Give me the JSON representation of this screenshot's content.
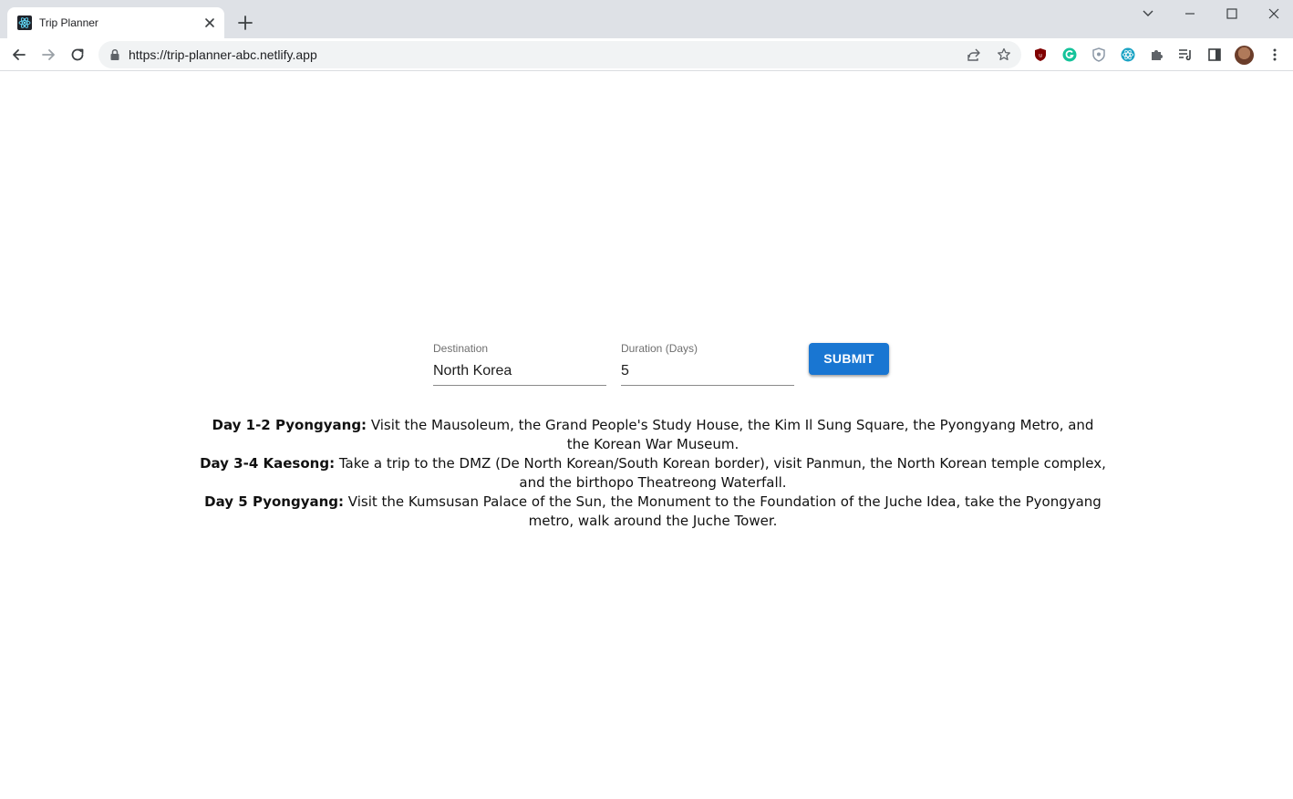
{
  "browser": {
    "tab": {
      "title": "Trip Planner",
      "favicon": "react-atom-icon"
    },
    "address_bar": {
      "url": "https://trip-planner-abc.netlify.app"
    },
    "colors": {
      "tab_strip": "#dee1e6",
      "omnibox": "#f1f3f4"
    }
  },
  "form": {
    "destination": {
      "label": "Destination",
      "value": "North Korea"
    },
    "duration": {
      "label": "Duration (Days)",
      "value": "5"
    },
    "submit_label": "SUBMIT",
    "submit_color": "#1976d2"
  },
  "itinerary": [
    {
      "heading": "Day 1-2 Pyongyang:",
      "text": " Visit the Mausoleum, the Grand People's Study House, the Kim Il Sung Square, the Pyongyang Metro, and the Korean War Museum."
    },
    {
      "heading": "Day 3-4 Kaesong:",
      "text": " Take a trip to the DMZ (De North Korean/South Korean border), visit Panmun, the North Korean temple complex, and the birthopo Theatreong Waterfall."
    },
    {
      "heading": "Day 5 Pyongyang:",
      "text": " Visit the Kumsusan Palace of the Sun, the Monument to the Foundation of the Juche Idea, take the Pyongyang metro, walk around the Juche Tower."
    }
  ]
}
